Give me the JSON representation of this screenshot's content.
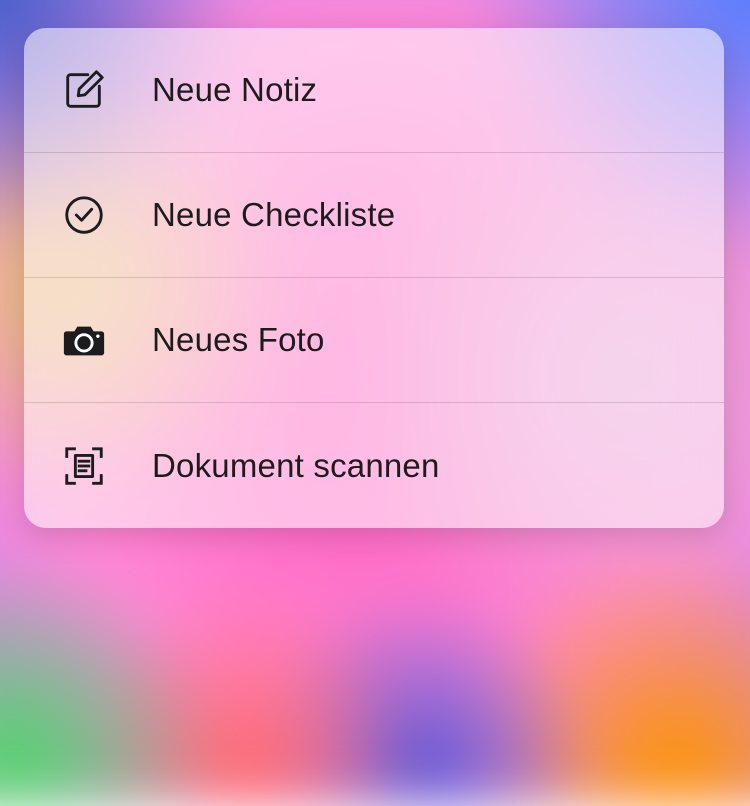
{
  "menu": {
    "items": [
      {
        "label": "Neue Notiz"
      },
      {
        "label": "Neue Checkliste"
      },
      {
        "label": "Neues Foto"
      },
      {
        "label": "Dokument scannen"
      }
    ]
  }
}
